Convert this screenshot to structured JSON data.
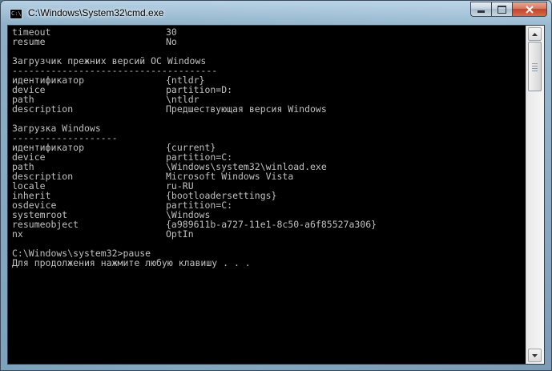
{
  "window": {
    "title": "C:\\Windows\\System32\\cmd.exe",
    "icon": "cmd-icon",
    "icon_text": "C:\\",
    "controls": {
      "minimize": "minimize-icon",
      "maximize": "maximize-icon",
      "close": "close-icon"
    }
  },
  "console": {
    "background": "#000000",
    "foreground": "#c0c0c0",
    "lines": [
      {
        "k": "timeout",
        "v": "30"
      },
      {
        "k": "resume",
        "v": "No"
      },
      {
        "t": ""
      },
      {
        "t": "Загрузчик прежних версий ОС Windows"
      },
      {
        "t": "-------------------------------------"
      },
      {
        "k": "идентификатор",
        "v": "{ntldr}"
      },
      {
        "k": "device",
        "v": "partition=D:"
      },
      {
        "k": "path",
        "v": "\\ntldr"
      },
      {
        "k": "description",
        "v": "Предшествующая версия Windows"
      },
      {
        "t": ""
      },
      {
        "t": "Загрузка Windows"
      },
      {
        "t": "-------------------"
      },
      {
        "k": "идентификатор",
        "v": "{current}"
      },
      {
        "k": "device",
        "v": "partition=C:"
      },
      {
        "k": "path",
        "v": "\\Windows\\system32\\winload.exe"
      },
      {
        "k": "description",
        "v": "Microsoft Windows Vista"
      },
      {
        "k": "locale",
        "v": "ru-RU"
      },
      {
        "k": "inherit",
        "v": "{bootloadersettings}"
      },
      {
        "k": "osdevice",
        "v": "partition=C:"
      },
      {
        "k": "systemroot",
        "v": "\\Windows"
      },
      {
        "k": "resumeobject",
        "v": "{a989611b-a727-11e1-8c50-a6f85527a306}"
      },
      {
        "k": "nx",
        "v": "OptIn"
      },
      {
        "t": ""
      },
      {
        "t": "C:\\Windows\\system32>pause"
      },
      {
        "t": "Для продолжения нажмите любую клавишу . . ."
      }
    ]
  }
}
